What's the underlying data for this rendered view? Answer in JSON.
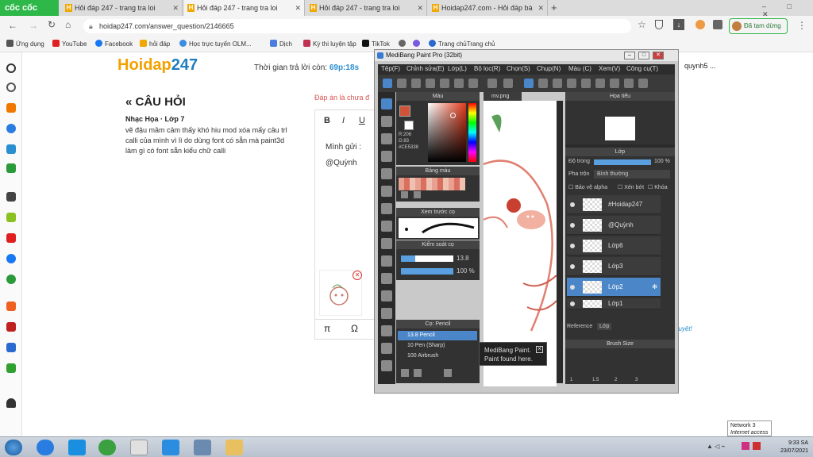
{
  "browser": {
    "brand": "cốc cốc",
    "tabs": [
      {
        "label": "Hỏi đáp 247 - trang tra loi"
      },
      {
        "label": "Hỏi đáp 247 - trang tra loi"
      },
      {
        "label": "Hỏi đáp 247 - trang tra loi"
      },
      {
        "label": "Hoidap247.com - Hỏi đáp bà"
      }
    ],
    "url": "hoidap247.com/answer_question/2146665",
    "paused_label": "Đã tạm dừng",
    "bookmarks": [
      "Ứng dụng",
      "YouTube",
      "Facebook",
      "hỏi đáp",
      "Học trực tuyến OLM...",
      "Dịch",
      "Kỳ thi luyện tập",
      "TikTok",
      "Trang chủTrang chủ"
    ]
  },
  "page": {
    "logo_main": "Hoidap",
    "logo_num": "247",
    "timer_label": "Thời gian trả lời còn:",
    "timer_value": "69p:18s",
    "username": "quynh5 ...",
    "question_title": "« CÂU HỎI",
    "question_subject": "Nhạc Họa · Lớp 7",
    "question_body": "vẽ đậu mầm cảm thấy khó hiu mod xóa mấy câu trl calli của mình vì lì do dùng font có sẵn mà paint3d làm gì có font sẵn kiểu chữ calli",
    "answer_label": "Đáp án là chưa đ",
    "editor_bold": "B",
    "editor_italic": "I",
    "editor_underline": "U",
    "answer_line1": "Mình gửi :",
    "answer_line2": "@Quỳnh",
    "pi_symbol": "π",
    "omega_symbol": "Ω",
    "send_hint": "duyệt!"
  },
  "medibang": {
    "title": "MediBang Paint Pro (32bit)",
    "menu": [
      "Tệp(F)",
      "Chỉnh sửa(E)",
      "Lớp(L)",
      "Bộ lọc(R)",
      "Chọn(S)",
      "Chụp(N)",
      "Màu (C)",
      "Xem(V)",
      "Công cụ(T)"
    ],
    "color_panel": "Màu",
    "color_r": "R:206",
    "color_g": "G:83",
    "color_hex": "#CE5338",
    "palette_panel": "Bảng màu",
    "preview_panel": "Xem trước cọ",
    "brush_control_panel": "Kiểm soát cọ",
    "brush_size_value": "13.8",
    "brush_opacity_value": "100 %",
    "brush_panel": "Cọ: Pencil",
    "brushes": [
      {
        "size": "13.8",
        "name": "Pencil"
      },
      {
        "size": "10",
        "name": "Pen (Sharp)"
      },
      {
        "size": "100",
        "name": "Airbrush"
      }
    ],
    "canvas_tab": "mv.png",
    "navigator_panel": "Họa tiểu",
    "layer_panel": "Lớp",
    "opacity_label": "Độ trong",
    "opacity_value": "100 %",
    "blend_label": "Pha trộn",
    "blend_value": "Bình thường",
    "protect_alpha": "Bảo vệ alpha",
    "clipping": "Xén bớt",
    "lock": "Khóa",
    "layers": [
      {
        "name": "#Hoidap247"
      },
      {
        "name": "@Quỳnh"
      },
      {
        "name": "Lớp6"
      },
      {
        "name": "Lớp3"
      },
      {
        "name": "Lớp2"
      },
      {
        "name": "Lớp1"
      }
    ],
    "tab_reference": "Reference",
    "tab_layer": "Lớp",
    "brush_size_panel": "Brush Size",
    "brush_sizes": [
      "1",
      "1.5",
      "2",
      "3"
    ],
    "tooltip": "MediBang Paint. Paint found here.",
    "selected_color": "#ce5338"
  },
  "taskbar": {
    "network_label": "Network 3",
    "network_status": "Internet access",
    "time": "9:33 SA",
    "date": "23/07/2021"
  }
}
